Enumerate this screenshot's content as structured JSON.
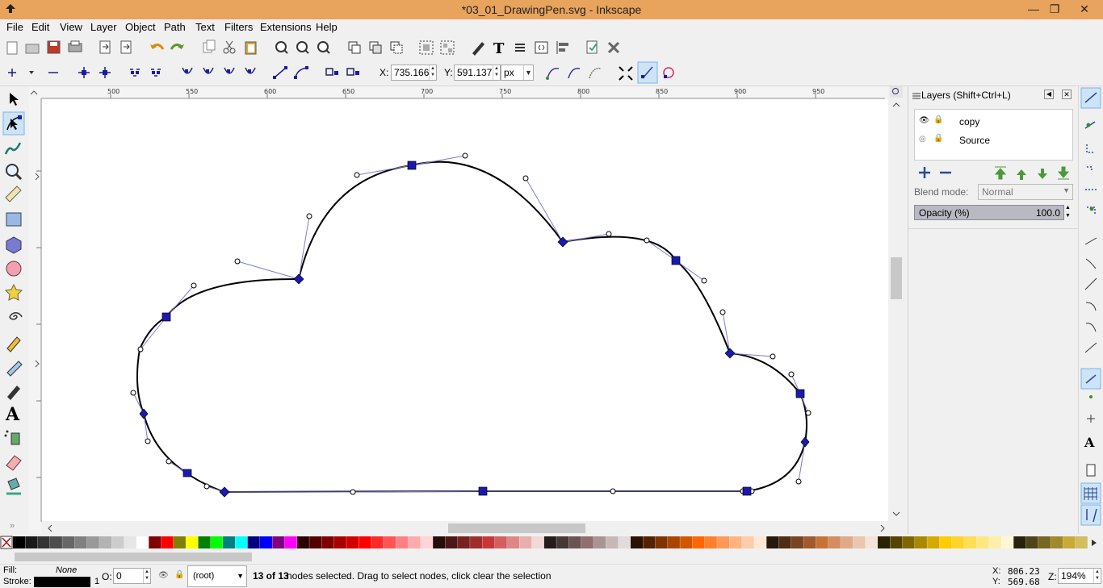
{
  "window": {
    "title": "*03_01_DrawingPen.svg - Inkscape",
    "buttons": {
      "minimize": "—",
      "maximize": "❐",
      "close": "✕"
    }
  },
  "menu": [
    "File",
    "Edit",
    "View",
    "Layer",
    "Object",
    "Path",
    "Text",
    "Filters",
    "Extensions",
    "Help"
  ],
  "command_bar": {
    "icons": [
      "new-document-icon",
      "open-icon",
      "save-icon",
      "print-icon",
      "import-icon",
      "export-icon",
      "undo-icon",
      "redo-icon",
      "copy-icon",
      "cut-icon",
      "paste-icon",
      "zoom-selection-icon",
      "zoom-drawing-icon",
      "zoom-page-icon",
      "duplicate-icon",
      "clone-icon",
      "unlink-clone-icon",
      "group-icon",
      "ungroup-icon",
      "fill-stroke-icon",
      "text-font-icon",
      "layers-icon",
      "xml-editor-icon",
      "align-icon",
      "document-properties-icon",
      "preferences-icon"
    ]
  },
  "node_toolbar": {
    "x_label": "X:",
    "x_value": "735.166",
    "y_label": "Y:",
    "y_value": "591.137",
    "unit": "px"
  },
  "tools": [
    "selector",
    "node",
    "tweak",
    "zoom",
    "measure",
    "rectangle",
    "3d-box",
    "ellipse",
    "star",
    "spiral",
    "pencil",
    "pen",
    "calligraphy",
    "text",
    "spray",
    "eraser",
    "paint-bucket"
  ],
  "active_tool": "node",
  "ruler": {
    "labels": [
      "500",
      "550",
      "600",
      "650",
      "700",
      "750",
      "800",
      "850",
      "900",
      "950"
    ]
  },
  "layers_panel": {
    "title": "Layers (Shift+Ctrl+L)",
    "layers": [
      {
        "name": "copy"
      },
      {
        "name": "Source"
      }
    ],
    "blend_mode_label": "Blend mode:",
    "blend_mode_value": "Normal",
    "opacity_label": "Opacity (%)",
    "opacity_value": "100.0",
    "opacity": 1.0
  },
  "status": {
    "fill_label": "Fill:",
    "fill_value": "None",
    "stroke_label": "Stroke:",
    "stroke_width": "1",
    "opacity_label": "O:",
    "opacity_value": "0",
    "layer_select": "(root)",
    "message_bold": "13 of 13",
    "message": " nodes selected. Drag to select nodes, click clear the selection",
    "cursor_x_label": "X:",
    "cursor_x": "806.23",
    "cursor_y_label": "Y:",
    "cursor_y": "569.68",
    "zoom_label": "Z:",
    "zoom_value": "194%"
  },
  "colors": {
    "titlebar": "#e8a35c",
    "accent": "#1a1ab0",
    "handle": "#7b7bd6"
  },
  "palette": [
    "#000000",
    "#1a1a1a",
    "#333333",
    "#4d4d4d",
    "#666666",
    "#808080",
    "#999999",
    "#b3b3b3",
    "#cccccc",
    "#e6e6e6",
    "#ffffff",
    "#800000",
    "#ff0000",
    "#808000",
    "#ffff00",
    "#008000",
    "#00ff00",
    "#008080",
    "#00ffff",
    "#000080",
    "#0000ff",
    "#800080",
    "#ff00ff",
    "#2b0000",
    "#550000",
    "#800000",
    "#aa0000",
    "#d40000",
    "#ff0000",
    "#ff2a2a",
    "#ff5555",
    "#ff8080",
    "#ffaaaa",
    "#ffd5d5",
    "#280b0b",
    "#501616",
    "#782121",
    "#a02c2c",
    "#c83737",
    "#d35f5f",
    "#de8787",
    "#e9afaf",
    "#f4d7d7",
    "#241c1c",
    "#483737",
    "#6c5353",
    "#916f6f",
    "#ac9393",
    "#c8b7b7",
    "#e3dbdb",
    "#2b1100",
    "#552200",
    "#803300",
    "#aa4400",
    "#d45500",
    "#ff6600",
    "#ff7f2a",
    "#ff9955",
    "#ffb380",
    "#ffccaa",
    "#ffe6d5",
    "#28170b",
    "#502d16",
    "#784421",
    "#a05a2c",
    "#c87137",
    "#d38d5f",
    "#deaa87",
    "#e9c6af",
    "#f4e3d7",
    "#2b2200",
    "#554400",
    "#806600",
    "#aa8800",
    "#d4aa00",
    "#ffcc00",
    "#ffd42a",
    "#ffdd55",
    "#ffe680",
    "#ffeeaa",
    "#fff6d5",
    "#28220b",
    "#504416",
    "#786721",
    "#a0892c",
    "#c8ab37",
    "#d4bd5f"
  ]
}
